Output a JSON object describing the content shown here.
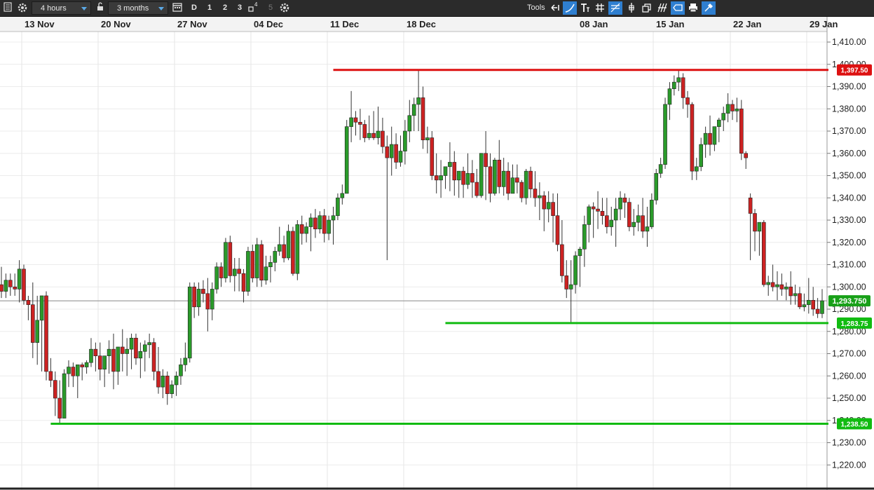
{
  "toolbar": {
    "interval": "4 hours",
    "range": "3 months",
    "day_buttons": [
      "D",
      "1",
      "2",
      "3"
    ],
    "disabled_day": "5",
    "superscript": "4",
    "tools_label": "Tools",
    "tool_icons": [
      "arrow-back-icon",
      "curve-icon",
      "text-icon",
      "grid-icon",
      "fibonacci-icon",
      "crosshair-icon",
      "layers-icon",
      "pitchfork-icon",
      "shapes-icon",
      "ellipse-icon",
      "print-icon",
      "settings-tool-icon"
    ]
  },
  "chart_data": {
    "type": "candlestick",
    "x_ticks": [
      "13 Nov",
      "20 Nov",
      "27 Nov",
      "04 Dec",
      "11 Dec",
      "18 Dec",
      "08 Jan",
      "15 Jan",
      "22 Jan",
      "29 Jan"
    ],
    "y_ticks": [
      "1,410.00",
      "1,400.00",
      "1,390.00",
      "1,380.00",
      "1,370.00",
      "1,360.00",
      "1,350.00",
      "1,340.00",
      "1,330.00",
      "1,320.00",
      "1,310.00",
      "1,300.00",
      "1,290.00",
      "1,280.00",
      "1,270.00",
      "1,260.00",
      "1,250.00",
      "1,240.00",
      "1,230.00",
      "1,220.00"
    ],
    "ylim": [
      1215,
      1412
    ],
    "current_price": {
      "label": "1,293.750",
      "value": 1293.75,
      "color": "#18a018"
    },
    "levels": [
      {
        "label": "1,397.50",
        "value": 1397.5,
        "color": "#dd1111",
        "start_index": 74
      },
      {
        "label": "1,283.75",
        "value": 1283.75,
        "color": "#11bb11",
        "start_index": 99
      },
      {
        "label": "1,238.50",
        "value": 1238.5,
        "color": "#11bb11",
        "start_index": 11
      }
    ],
    "up_color": "#2a9a2a",
    "down_color": "#cc2222",
    "candles": [
      [
        1301,
        1309,
        1295,
        1298
      ],
      [
        1298,
        1306,
        1295,
        1303
      ],
      [
        1303,
        1306,
        1296,
        1300
      ],
      [
        1300,
        1306,
        1296,
        1299
      ],
      [
        1299,
        1312,
        1293,
        1308
      ],
      [
        1308,
        1310,
        1292,
        1294
      ],
      [
        1294,
        1296,
        1285,
        1292
      ],
      [
        1292,
        1302,
        1268,
        1275
      ],
      [
        1275,
        1296,
        1265,
        1285
      ],
      [
        1285,
        1295,
        1262,
        1296
      ],
      [
        1296,
        1298,
        1258,
        1262
      ],
      [
        1262,
        1268,
        1255,
        1258
      ],
      [
        1258,
        1262,
        1242,
        1250
      ],
      [
        1250,
        1258,
        1238.5,
        1241
      ],
      [
        1241,
        1263,
        1242,
        1261
      ],
      [
        1261,
        1267,
        1255,
        1264
      ],
      [
        1264,
        1266,
        1255,
        1260
      ],
      [
        1260,
        1265,
        1250,
        1265
      ],
      [
        1265,
        1266,
        1258,
        1264
      ],
      [
        1264,
        1267,
        1261,
        1266
      ],
      [
        1266,
        1277,
        1264,
        1272
      ],
      [
        1272,
        1275,
        1262,
        1269
      ],
      [
        1269,
        1275,
        1258,
        1263
      ],
      [
        1263,
        1269,
        1255,
        1269
      ],
      [
        1269,
        1276,
        1261,
        1272
      ],
      [
        1272,
        1279,
        1254,
        1262
      ],
      [
        1262,
        1272,
        1256,
        1273
      ],
      [
        1273,
        1281,
        1262,
        1270
      ],
      [
        1270,
        1277,
        1260,
        1272
      ],
      [
        1272,
        1279,
        1263,
        1277
      ],
      [
        1277,
        1279,
        1265,
        1268
      ],
      [
        1268,
        1275,
        1259,
        1271
      ],
      [
        1271,
        1276,
        1262,
        1274
      ],
      [
        1274,
        1279,
        1268,
        1275
      ],
      [
        1275,
        1277,
        1258,
        1262
      ],
      [
        1262,
        1273,
        1252,
        1255
      ],
      [
        1255,
        1263,
        1250,
        1260
      ],
      [
        1260,
        1262,
        1247,
        1252
      ],
      [
        1252,
        1258,
        1250,
        1256
      ],
      [
        1256,
        1262,
        1251,
        1260
      ],
      [
        1260,
        1268,
        1256,
        1265
      ],
      [
        1265,
        1275,
        1262,
        1268
      ],
      [
        1268,
        1302,
        1266,
        1300
      ],
      [
        1300,
        1302,
        1286,
        1291
      ],
      [
        1291,
        1302,
        1287,
        1299
      ],
      [
        1299,
        1303,
        1293,
        1297
      ],
      [
        1297,
        1304,
        1280,
        1290
      ],
      [
        1290,
        1302,
        1285,
        1299
      ],
      [
        1299,
        1311,
        1297,
        1309
      ],
      [
        1309,
        1311,
        1300,
        1304
      ],
      [
        1304,
        1322,
        1302,
        1320
      ],
      [
        1320,
        1323,
        1302,
        1305
      ],
      [
        1305,
        1313,
        1298,
        1308
      ],
      [
        1308,
        1313,
        1298,
        1306
      ],
      [
        1306,
        1308,
        1293,
        1298
      ],
      [
        1298,
        1318,
        1296,
        1316
      ],
      [
        1316,
        1319,
        1302,
        1304
      ],
      [
        1304,
        1322,
        1300,
        1319
      ],
      [
        1319,
        1321,
        1300,
        1303
      ],
      [
        1303,
        1314,
        1301,
        1309
      ],
      [
        1309,
        1314,
        1302,
        1311
      ],
      [
        1311,
        1318,
        1307,
        1316
      ],
      [
        1316,
        1327,
        1314,
        1319
      ],
      [
        1319,
        1323,
        1311,
        1313
      ],
      [
        1313,
        1328,
        1312,
        1325
      ],
      [
        1325,
        1327,
        1305,
        1306
      ],
      [
        1306,
        1330,
        1303,
        1328
      ],
      [
        1328,
        1332,
        1319,
        1324
      ],
      [
        1324,
        1329,
        1320,
        1327
      ],
      [
        1327,
        1333,
        1316,
        1331
      ],
      [
        1331,
        1335,
        1322,
        1326
      ],
      [
        1326,
        1334,
        1324,
        1332
      ],
      [
        1332,
        1335,
        1320,
        1324
      ],
      [
        1324,
        1332,
        1321,
        1330
      ],
      [
        1330,
        1336,
        1319,
        1332
      ],
      [
        1332,
        1342,
        1330,
        1340
      ],
      [
        1340,
        1346,
        1337,
        1342
      ],
      [
        1342,
        1375,
        1346,
        1372
      ],
      [
        1372,
        1388,
        1365,
        1376
      ],
      [
        1376,
        1379,
        1368,
        1374
      ],
      [
        1374,
        1380,
        1366,
        1373
      ],
      [
        1373,
        1375,
        1365,
        1367
      ],
      [
        1367,
        1377,
        1366,
        1369
      ],
      [
        1369,
        1379,
        1366,
        1367
      ],
      [
        1367,
        1381,
        1364,
        1370
      ],
      [
        1370,
        1376,
        1360,
        1363
      ],
      [
        1363,
        1368,
        1312,
        1358
      ],
      [
        1358,
        1372,
        1350,
        1364
      ],
      [
        1364,
        1369,
        1353,
        1356
      ],
      [
        1356,
        1368,
        1354,
        1361
      ],
      [
        1361,
        1375,
        1355,
        1370
      ],
      [
        1370,
        1384,
        1365,
        1377
      ],
      [
        1377,
        1385,
        1370,
        1382
      ],
      [
        1382,
        1397.5,
        1370,
        1385
      ],
      [
        1385,
        1390,
        1362,
        1366
      ],
      [
        1366,
        1372,
        1360,
        1367
      ],
      [
        1367,
        1370,
        1348,
        1350
      ],
      [
        1350,
        1360,
        1342,
        1348
      ],
      [
        1348,
        1357,
        1340,
        1350
      ],
      [
        1350,
        1352,
        1344,
        1354
      ],
      [
        1354,
        1365,
        1343,
        1356
      ],
      [
        1356,
        1361,
        1341,
        1348
      ],
      [
        1348,
        1351,
        1340,
        1352
      ],
      [
        1352,
        1354,
        1340,
        1346
      ],
      [
        1346,
        1360,
        1344,
        1351
      ],
      [
        1351,
        1357,
        1340,
        1347
      ],
      [
        1347,
        1353,
        1340,
        1341
      ],
      [
        1341,
        1352,
        1340,
        1360
      ],
      [
        1360,
        1370,
        1339,
        1354
      ],
      [
        1354,
        1360,
        1338,
        1342
      ],
      [
        1342,
        1358,
        1341,
        1357
      ],
      [
        1357,
        1366,
        1342,
        1345
      ],
      [
        1345,
        1358,
        1341,
        1352
      ],
      [
        1352,
        1356,
        1339,
        1342
      ],
      [
        1342,
        1355,
        1342,
        1349
      ],
      [
        1349,
        1355,
        1342,
        1347
      ],
      [
        1347,
        1348,
        1338,
        1340
      ],
      [
        1340,
        1353,
        1337,
        1352
      ],
      [
        1352,
        1354,
        1340,
        1344
      ],
      [
        1344,
        1352,
        1336,
        1340
      ],
      [
        1340,
        1347,
        1330,
        1341
      ],
      [
        1341,
        1343,
        1325,
        1335
      ],
      [
        1335,
        1343,
        1329,
        1338
      ],
      [
        1338,
        1342,
        1320,
        1332
      ],
      [
        1332,
        1342,
        1316,
        1319
      ],
      [
        1319,
        1330,
        1302,
        1305
      ],
      [
        1305,
        1312,
        1295,
        1299
      ],
      [
        1299,
        1312,
        1283.75,
        1301
      ],
      [
        1301,
        1316,
        1297,
        1314
      ],
      [
        1314,
        1318,
        1300,
        1317
      ],
      [
        1317,
        1332,
        1309,
        1328
      ],
      [
        1328,
        1337,
        1320,
        1336
      ],
      [
        1336,
        1338,
        1322,
        1335
      ],
      [
        1335,
        1343,
        1326,
        1334
      ],
      [
        1334,
        1340,
        1328,
        1332
      ],
      [
        1332,
        1340,
        1324,
        1327
      ],
      [
        1327,
        1336,
        1323,
        1330
      ],
      [
        1330,
        1340,
        1318,
        1335
      ],
      [
        1335,
        1343,
        1330,
        1340
      ],
      [
        1340,
        1342,
        1331,
        1338
      ],
      [
        1338,
        1340,
        1325,
        1327
      ],
      [
        1327,
        1335,
        1323,
        1329
      ],
      [
        1329,
        1337,
        1325,
        1332
      ],
      [
        1332,
        1340,
        1322,
        1325
      ],
      [
        1325,
        1336,
        1318,
        1327
      ],
      [
        1327,
        1342,
        1326,
        1339
      ],
      [
        1339,
        1353,
        1337,
        1351
      ],
      [
        1351,
        1358,
        1349,
        1355
      ],
      [
        1355,
        1385,
        1353,
        1382
      ],
      [
        1382,
        1392,
        1375,
        1389
      ],
      [
        1389,
        1395,
        1386,
        1392
      ],
      [
        1392,
        1397.5,
        1388,
        1394
      ],
      [
        1394,
        1396,
        1380,
        1385
      ],
      [
        1385,
        1388,
        1376,
        1382
      ],
      [
        1382,
        1383,
        1348,
        1352
      ],
      [
        1352,
        1358,
        1348,
        1354
      ],
      [
        1354,
        1367,
        1352,
        1364
      ],
      [
        1364,
        1372,
        1358,
        1369
      ],
      [
        1369,
        1377,
        1359,
        1364
      ],
      [
        1364,
        1370,
        1361,
        1372
      ],
      [
        1372,
        1376,
        1365,
        1375
      ],
      [
        1375,
        1381,
        1370,
        1378
      ],
      [
        1378,
        1387,
        1374,
        1382
      ],
      [
        1382,
        1384,
        1375,
        1379
      ],
      [
        1379,
        1385,
        1374,
        1380
      ],
      [
        1380,
        1384,
        1357,
        1360
      ],
      [
        1360,
        1361,
        1353,
        1358
      ],
      [
        1340,
        1342,
        1312,
        1333
      ],
      [
        1333,
        1335,
        1316,
        1325
      ],
      [
        1325,
        1328,
        1314,
        1329
      ],
      [
        1329,
        1330,
        1300,
        1301
      ],
      [
        1301,
        1305,
        1296,
        1302
      ],
      [
        1302,
        1310,
        1298,
        1300
      ],
      [
        1300,
        1307,
        1294,
        1301
      ],
      [
        1301,
        1306,
        1296,
        1299
      ],
      [
        1299,
        1302,
        1294,
        1300
      ],
      [
        1300,
        1307,
        1292,
        1296
      ],
      [
        1296,
        1301,
        1292,
        1297
      ],
      [
        1297,
        1300,
        1290,
        1291
      ],
      [
        1291,
        1297,
        1289,
        1292
      ],
      [
        1292,
        1304,
        1288,
        1294
      ],
      [
        1294,
        1300,
        1287,
        1290
      ],
      [
        1290,
        1295,
        1286,
        1288
      ],
      [
        1288,
        1299,
        1286,
        1293.75
      ]
    ]
  }
}
